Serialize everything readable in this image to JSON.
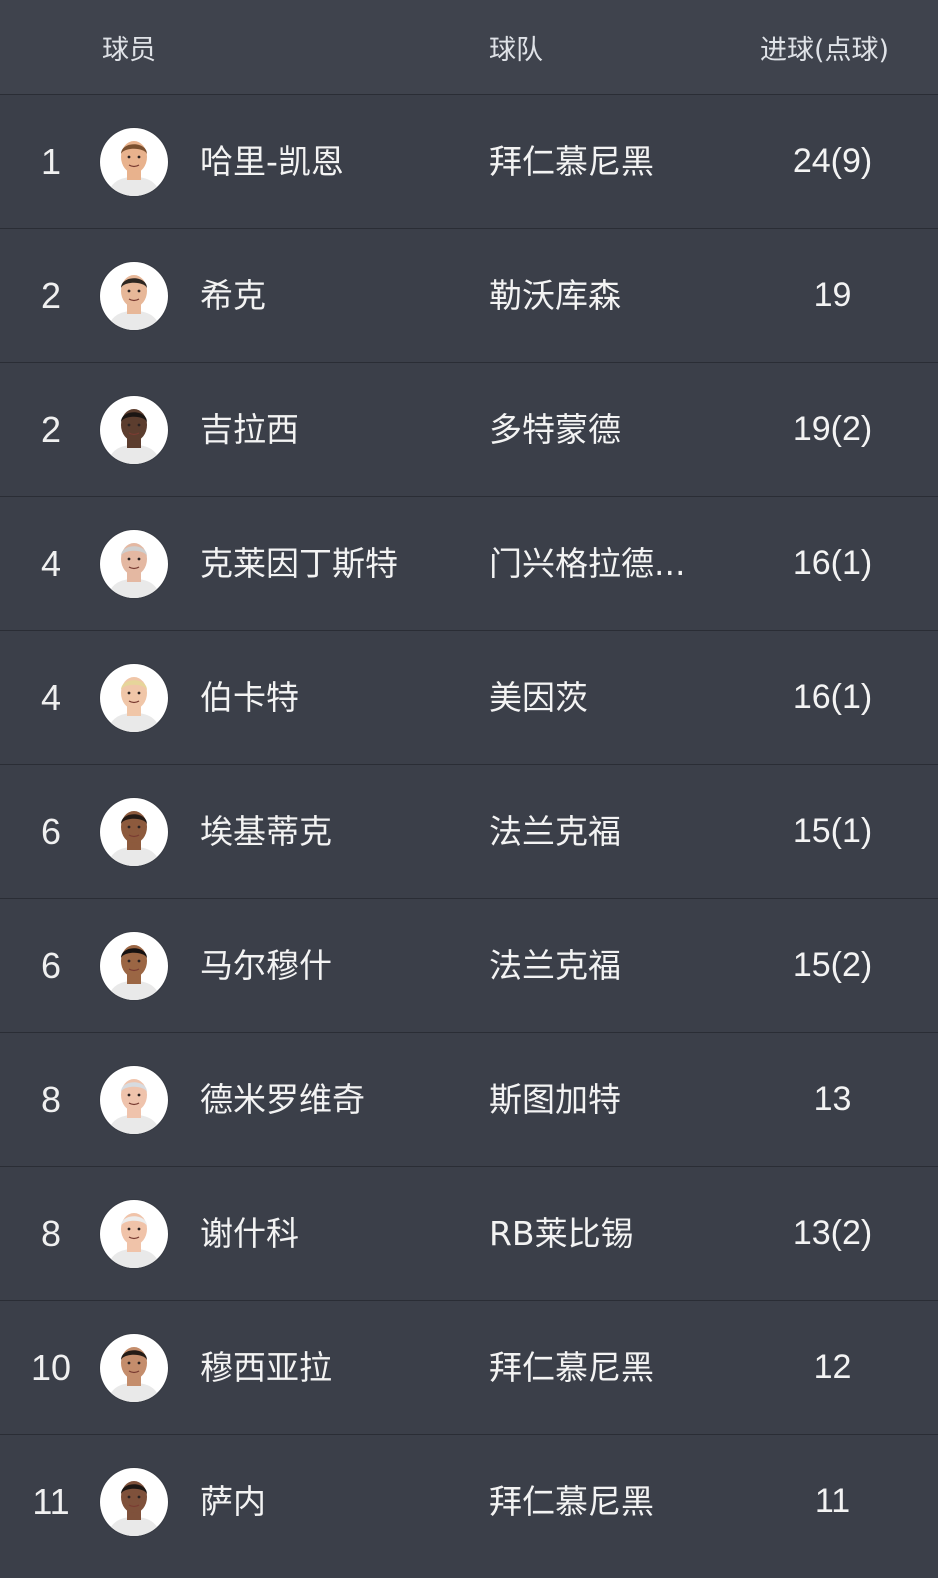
{
  "accent_color": "#53b84f",
  "header": {
    "player": "球员",
    "team": "球队",
    "goals": "进球(点球)"
  },
  "rows": [
    {
      "rank": "1",
      "name": "哈里-凯恩",
      "team": "拜仁慕尼黑",
      "goals": "24(9)",
      "avatar_icon": "player-headshot-icon",
      "skin": "#e8b28d",
      "hair": "#7a5030"
    },
    {
      "rank": "2",
      "name": "希克",
      "team": "勒沃库森",
      "goals": "19",
      "avatar_icon": "player-headshot-icon",
      "skin": "#e7b798",
      "hair": "#2d2621"
    },
    {
      "rank": "2",
      "name": "吉拉西",
      "team": "多特蒙德",
      "goals": "19(2)",
      "avatar_icon": "player-headshot-icon",
      "skin": "#5c3d2e",
      "hair": "#1b1513"
    },
    {
      "rank": "4",
      "name": "克莱因丁斯特",
      "team": "门兴格拉德...",
      "goals": "16(1)",
      "avatar_icon": "player-headshot-icon",
      "skin": "#e4b8a2",
      "hair": "#cfcfcf"
    },
    {
      "rank": "4",
      "name": "伯卡特",
      "team": "美因茨",
      "goals": "16(1)",
      "avatar_icon": "player-headshot-icon",
      "skin": "#f0c6a8",
      "hair": "#e6d59a"
    },
    {
      "rank": "6",
      "name": "埃基蒂克",
      "team": "法兰克福",
      "goals": "15(1)",
      "avatar_icon": "player-headshot-icon",
      "skin": "#8d5a3d",
      "hair": "#241a15"
    },
    {
      "rank": "6",
      "name": "马尔穆什",
      "team": "法兰克福",
      "goals": "15(2)",
      "avatar_icon": "player-headshot-icon",
      "skin": "#9b6644",
      "hair": "#151110"
    },
    {
      "rank": "8",
      "name": "德米罗维奇",
      "team": "斯图加特",
      "goals": "13",
      "avatar_icon": "player-headshot-icon",
      "skin": "#efc3ac",
      "hair": "#d7dbe0"
    },
    {
      "rank": "8",
      "name": "谢什科",
      "team": "RB莱比锡",
      "goals": "13(2)",
      "avatar_icon": "player-headshot-icon",
      "skin": "#f0c3a9",
      "hair": "#ececec"
    },
    {
      "rank": "10",
      "name": "穆西亚拉",
      "team": "拜仁慕尼黑",
      "goals": "12",
      "avatar_icon": "player-headshot-icon",
      "skin": "#c48d6c",
      "hair": "#231b16"
    },
    {
      "rank": "11",
      "name": "萨内",
      "team": "拜仁慕尼黑",
      "goals": "11",
      "avatar_icon": "player-headshot-icon",
      "skin": "#7f513b",
      "hair": "#1d1714"
    }
  ]
}
